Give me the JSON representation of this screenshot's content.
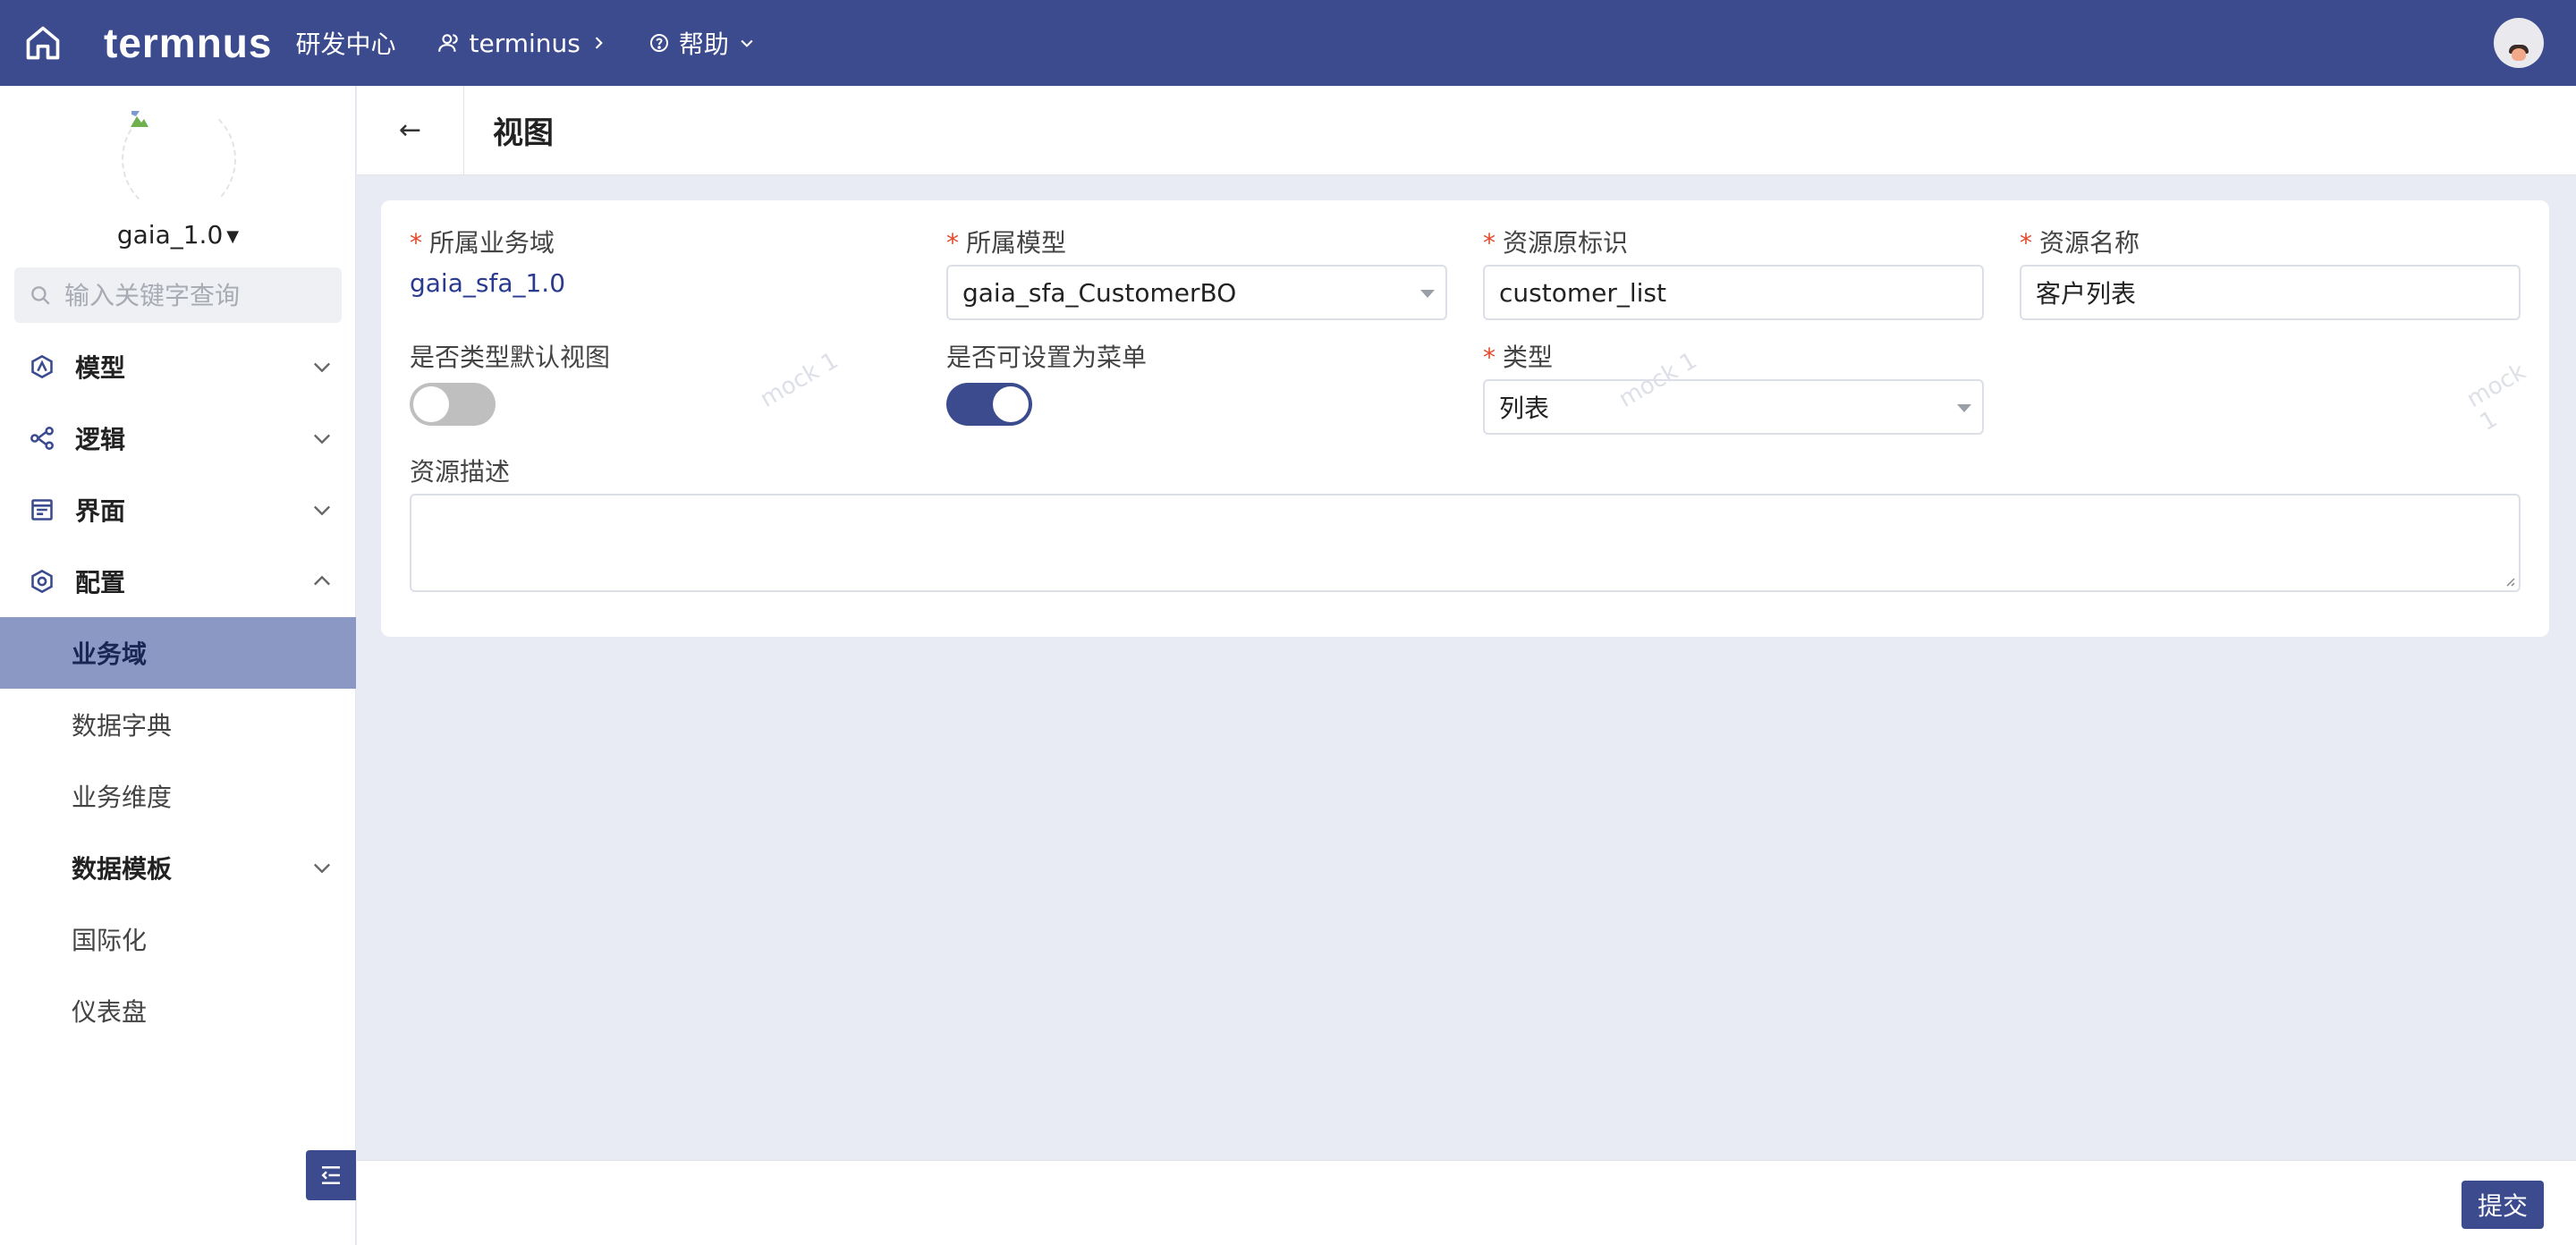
{
  "topbar": {
    "logo": "termnus",
    "dev_center": "研发中心",
    "workspace": "terminus",
    "help": "帮助"
  },
  "sidebar": {
    "version": "gaia_1.0",
    "search_placeholder": "输入关键字查询",
    "menu": {
      "model": "模型",
      "logic": "逻辑",
      "ui": "界面",
      "config": "配置"
    },
    "sub_items": {
      "business_domain": "业务域",
      "data_dictionary": "数据字典",
      "business_dimension": "业务维度",
      "data_template": "数据模板",
      "i18n": "国际化",
      "dashboard": "仪表盘"
    }
  },
  "page": {
    "back": "←",
    "title": "视图"
  },
  "form": {
    "domain": {
      "label": "所属业务域",
      "value": "gaia_sfa_1.0"
    },
    "model": {
      "label": "所属模型",
      "value": "gaia_sfa_CustomerBO"
    },
    "resource_key": {
      "label": "资源原标识",
      "value": "customer_list"
    },
    "resource_name": {
      "label": "资源名称",
      "value": "客户列表"
    },
    "default_view": {
      "label": "是否类型默认视图",
      "on": false
    },
    "menu_settable": {
      "label": "是否可设置为菜单",
      "on": true
    },
    "type": {
      "label": "类型",
      "value": "列表"
    },
    "description": {
      "label": "资源描述",
      "value": ""
    }
  },
  "watermark": "mock 1",
  "footer": {
    "submit": "提交"
  },
  "colors": {
    "primary": "#3c4b8e",
    "required": "#e5482d",
    "active_menu": "#8c98c4"
  }
}
